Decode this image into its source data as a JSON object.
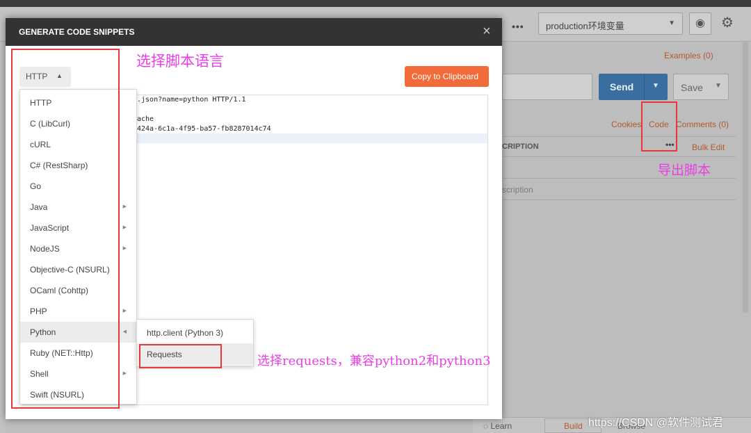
{
  "background": {
    "more_label": "•••",
    "environment_select": "production环境变量",
    "examples_label": "Examples (0)",
    "send_label": "Send",
    "save_label": "Save",
    "cookies_label": "Cookies",
    "code_label": "Code",
    "comments_label": "Comments (0)",
    "description_header": "CRIPTION",
    "bulk_edit_label": "Bulk Edit",
    "description_placeholder": "scription",
    "learn_label": "Learn",
    "build_label": "Build",
    "browse_label": "Browse"
  },
  "modal": {
    "title": "GENERATE CODE SNIPPETS",
    "close_icon": "×",
    "selected_language": "HTTP",
    "copy_button_label": "Copy to Clipboard",
    "code_lines": [
      ".json?name=python HTTP/1.1",
      "",
      "ache",
      "424a-6c1a-4f95-ba57-fb8287014c74"
    ],
    "languages": [
      {
        "label": "HTTP",
        "has_submenu": false
      },
      {
        "label": "C (LibCurl)",
        "has_submenu": false
      },
      {
        "label": "cURL",
        "has_submenu": false
      },
      {
        "label": "C# (RestSharp)",
        "has_submenu": false
      },
      {
        "label": "Go",
        "has_submenu": false
      },
      {
        "label": "Java",
        "has_submenu": true
      },
      {
        "label": "JavaScript",
        "has_submenu": true
      },
      {
        "label": "NodeJS",
        "has_submenu": true
      },
      {
        "label": "Objective-C (NSURL)",
        "has_submenu": false
      },
      {
        "label": "OCaml (Cohttp)",
        "has_submenu": false
      },
      {
        "label": "PHP",
        "has_submenu": true
      },
      {
        "label": "Python",
        "has_submenu": true,
        "active": true
      },
      {
        "label": "Ruby (NET::Http)",
        "has_submenu": false
      },
      {
        "label": "Shell",
        "has_submenu": true
      },
      {
        "label": "Swift (NSURL)",
        "has_submenu": false
      }
    ],
    "python_submenu": [
      {
        "label": "http.client (Python 3)"
      },
      {
        "label": "Requests",
        "active": true
      }
    ]
  },
  "annotations": {
    "select_language": "选择脚本语言",
    "export_script": "导出脚本",
    "select_requests": "选择requests，兼容python2和python3"
  },
  "watermark": "https://CSDN @软件测试君",
  "colors": {
    "accent_orange": "#f26b3a",
    "send_blue": "#3b6ea0",
    "annotation_magenta": "#e93ee6",
    "annotation_red": "#e8363b"
  }
}
